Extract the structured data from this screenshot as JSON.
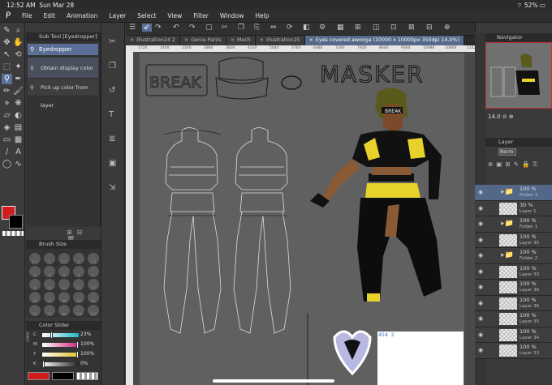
{
  "status": {
    "time": "12:52 AM",
    "date": "Sun Mar 28",
    "battery": "52%"
  },
  "menu": [
    "File",
    "Edit",
    "Animation",
    "Layer",
    "Select",
    "View",
    "Filter",
    "Window",
    "Help"
  ],
  "subtool": {
    "header": "Sub Tool [Eyedropper]",
    "selected": "Eyedropper",
    "items": [
      "Obtain display color",
      "Pick up color from layer"
    ]
  },
  "brush": {
    "header": "Brush Size",
    "sizes": [
      "0.7",
      "1",
      "1.5",
      "2",
      "2.5",
      "3",
      "4",
      "5",
      "6",
      "7",
      "8",
      "10",
      "12",
      "15",
      "17",
      "20",
      "25",
      "30",
      "40",
      "50",
      "60",
      "70",
      "80",
      "100",
      "120"
    ]
  },
  "color_slider": {
    "header": "Color Slider",
    "mode": "CMYK",
    "channels": [
      {
        "label": "C",
        "value": "23%",
        "fill": 0.23,
        "color": "#1fb5c8"
      },
      {
        "label": "M",
        "value": "100%",
        "fill": 1.0,
        "color": "#d0207a"
      },
      {
        "label": "Y",
        "value": "100%",
        "fill": 1.0,
        "color": "#e0c020"
      },
      {
        "label": "K",
        "value": "0%",
        "fill": 0.0,
        "color": "#222222"
      }
    ],
    "main_color": "#d01c1c"
  },
  "tabs": [
    {
      "label": "Illustration24 2",
      "active": false
    },
    {
      "label": "Genie Pants",
      "active": false
    },
    {
      "label": "Mech",
      "active": false
    },
    {
      "label": "Illustration25",
      "active": false
    },
    {
      "label": "Eyes covered awooga (10000 x 10000px 350dpi 14.0%)",
      "active": true
    }
  ],
  "ruler_ticks": [
    "1720",
    "1440",
    "2160",
    "2880",
    "3600",
    "4320",
    "5040",
    "5760",
    "6480",
    "7200",
    "7920",
    "8640",
    "9360",
    "10080",
    "10800",
    "11520"
  ],
  "artwork": {
    "break_text": "BREAK",
    "title": "MASKER",
    "mask_text": "BREAK",
    "sticker_number": "454 2"
  },
  "navigator": {
    "header": "Navigator",
    "zoom": "14.0"
  },
  "layer_panel": {
    "header": "Layer",
    "blend": "Norm",
    "layers": [
      {
        "pct": "100 %",
        "name": "Folder 3",
        "folder": true,
        "selected": true
      },
      {
        "pct": "30 %",
        "name": "Layer 1",
        "folder": false,
        "selected": false
      },
      {
        "pct": "100 %",
        "name": "Folder 1",
        "folder": true,
        "selected": false
      },
      {
        "pct": "100 %",
        "name": "Layer 35",
        "folder": false,
        "selected": false
      },
      {
        "pct": "100 %",
        "name": "Folder 2",
        "folder": true,
        "selected": false
      },
      {
        "pct": "100 %",
        "name": "Layer 33",
        "folder": false,
        "selected": false
      },
      {
        "pct": "100 %",
        "name": "Layer 36",
        "folder": false,
        "selected": false
      },
      {
        "pct": "100 %",
        "name": "Layer 36",
        "folder": false,
        "selected": false
      },
      {
        "pct": "100 %",
        "name": "Layer 35",
        "folder": false,
        "selected": false
      },
      {
        "pct": "100 %",
        "name": "Layer 34",
        "folder": false,
        "selected": false
      },
      {
        "pct": "100 %",
        "name": "Layer 33",
        "folder": false,
        "selected": false
      }
    ]
  }
}
